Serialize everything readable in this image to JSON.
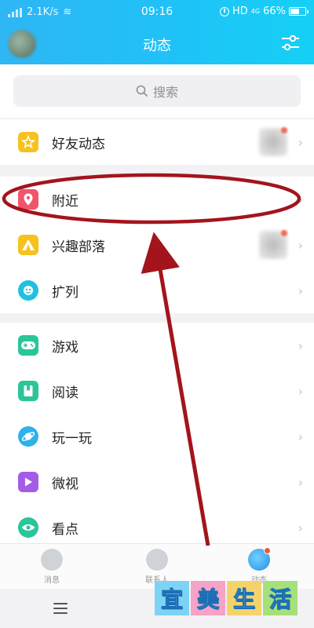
{
  "status_bar": {
    "network_speed": "2.1K/s",
    "time": "09:16",
    "hd_label": "HD",
    "net_type": "4G",
    "battery": "66%",
    "battery_level": 0.66
  },
  "header": {
    "title": "动态"
  },
  "search": {
    "placeholder": "搜索"
  },
  "groups": [
    {
      "items": [
        {
          "label": "好友动态",
          "icon": "star-icon",
          "color": "#f7c11e",
          "has_thumb": true
        }
      ]
    },
    {
      "items": [
        {
          "label": "附近",
          "icon": "location-pin-icon",
          "color": "#f2546b",
          "has_thumb": false
        },
        {
          "label": "兴趣部落",
          "icon": "tent-icon",
          "color": "#f7c11e",
          "has_thumb": true
        },
        {
          "label": "扩列",
          "icon": "gamepad-face-icon",
          "color": "#21c0e0",
          "has_thumb": false
        }
      ]
    },
    {
      "items": [
        {
          "label": "游戏",
          "icon": "gamepad-icon",
          "color": "#2bc59b",
          "has_thumb": false
        },
        {
          "label": "阅读",
          "icon": "book-icon",
          "color": "#2bc59b",
          "has_thumb": false
        },
        {
          "label": "玩一玩",
          "icon": "planet-icon",
          "color": "#2fb1ec",
          "has_thumb": false
        },
        {
          "label": "微视",
          "icon": "play-icon",
          "color": "#a45ce8",
          "has_thumb": false
        },
        {
          "label": "看点",
          "icon": "eye-icon",
          "color": "#2bc59b",
          "has_thumb": false
        }
      ]
    }
  ],
  "tabbar": {
    "tabs": [
      {
        "label": "消息",
        "icon": "message-icon"
      },
      {
        "label": "联系人",
        "icon": "contacts-icon"
      },
      {
        "label": "动态",
        "icon": "planet-tab-icon"
      }
    ]
  },
  "watermark": {
    "chars": [
      "宜",
      "美",
      "生",
      "活"
    ],
    "colors": [
      "#7dd3f5",
      "#f5a3c7",
      "#f5d36b",
      "#a6e07a"
    ]
  },
  "colors": {
    "header_gradient_start": "#2fb6f5",
    "header_gradient_end": "#15d0f6",
    "annotation": "#a3141c"
  }
}
